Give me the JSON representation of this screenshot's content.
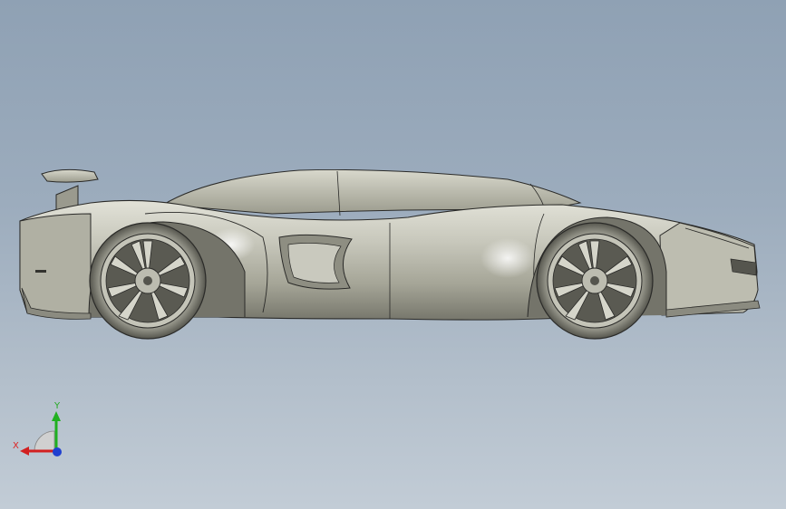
{
  "viewport": {
    "background_top": "#8fa1b4",
    "background_bottom": "#c2ccd6"
  },
  "model": {
    "name": "sports-car-side-view",
    "body_color": "#b8b8aa",
    "edge_color": "#2a2a28"
  },
  "triad": {
    "x_label": "X",
    "y_label": "Y",
    "x_color": "#d22020",
    "y_color": "#20b020",
    "z_color": "#2040d0"
  }
}
